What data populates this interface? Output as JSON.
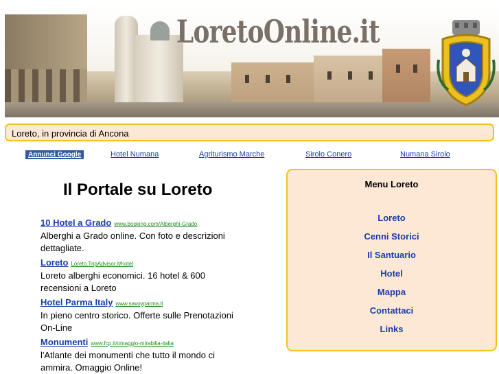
{
  "banner": {
    "title": "LoretoOnline.it",
    "crest_icon": "coat-of-arms-icon"
  },
  "location": "Loreto, in provincia di Ancona",
  "ad_row": {
    "label": "Annunci Google",
    "links": [
      "Hotel Numana",
      "Agriturismo Marche",
      "Sirolo Conero",
      "Numana Sirolo"
    ]
  },
  "main": {
    "title": "Il Portale su Loreto"
  },
  "ads": [
    {
      "title": "10 Hotel a Grado",
      "url": "www.booking.com/Alberghi-Grado",
      "desc": "Alberghi a Grado online. Con foto e descrizioni dettagliate."
    },
    {
      "title": "Loreto",
      "url": "Loreto.TripAdvisor.it/hotel",
      "desc": "Loreto alberghi economici. 16 hotel & 600 recensioni a Loreto"
    },
    {
      "title": "Hotel Parma Italy",
      "url": "www.savoyparma.it",
      "desc": "In pieno centro storico. Offerte sulle Prenotazioni On-Line"
    },
    {
      "title": "Monumenti",
      "url": "www.fcp.it/omaggio-mirabilia-italia",
      "desc": "l'Atlante dei monumenti che tutto il mondo ci ammira. Omaggio Online!"
    }
  ],
  "menu": {
    "title": "Menu Loreto",
    "items": [
      "Loreto",
      "Cenni Storici",
      "Il Santuario",
      "Hotel",
      "Mappa",
      "Contattaci",
      "Links"
    ]
  },
  "colors": {
    "link": "#1a3da6",
    "url_green": "#1d8a1d",
    "panel_bg": "#fde8d6",
    "panel_border": "#f3c21a",
    "ad_label_bg": "#2f5aa4"
  }
}
